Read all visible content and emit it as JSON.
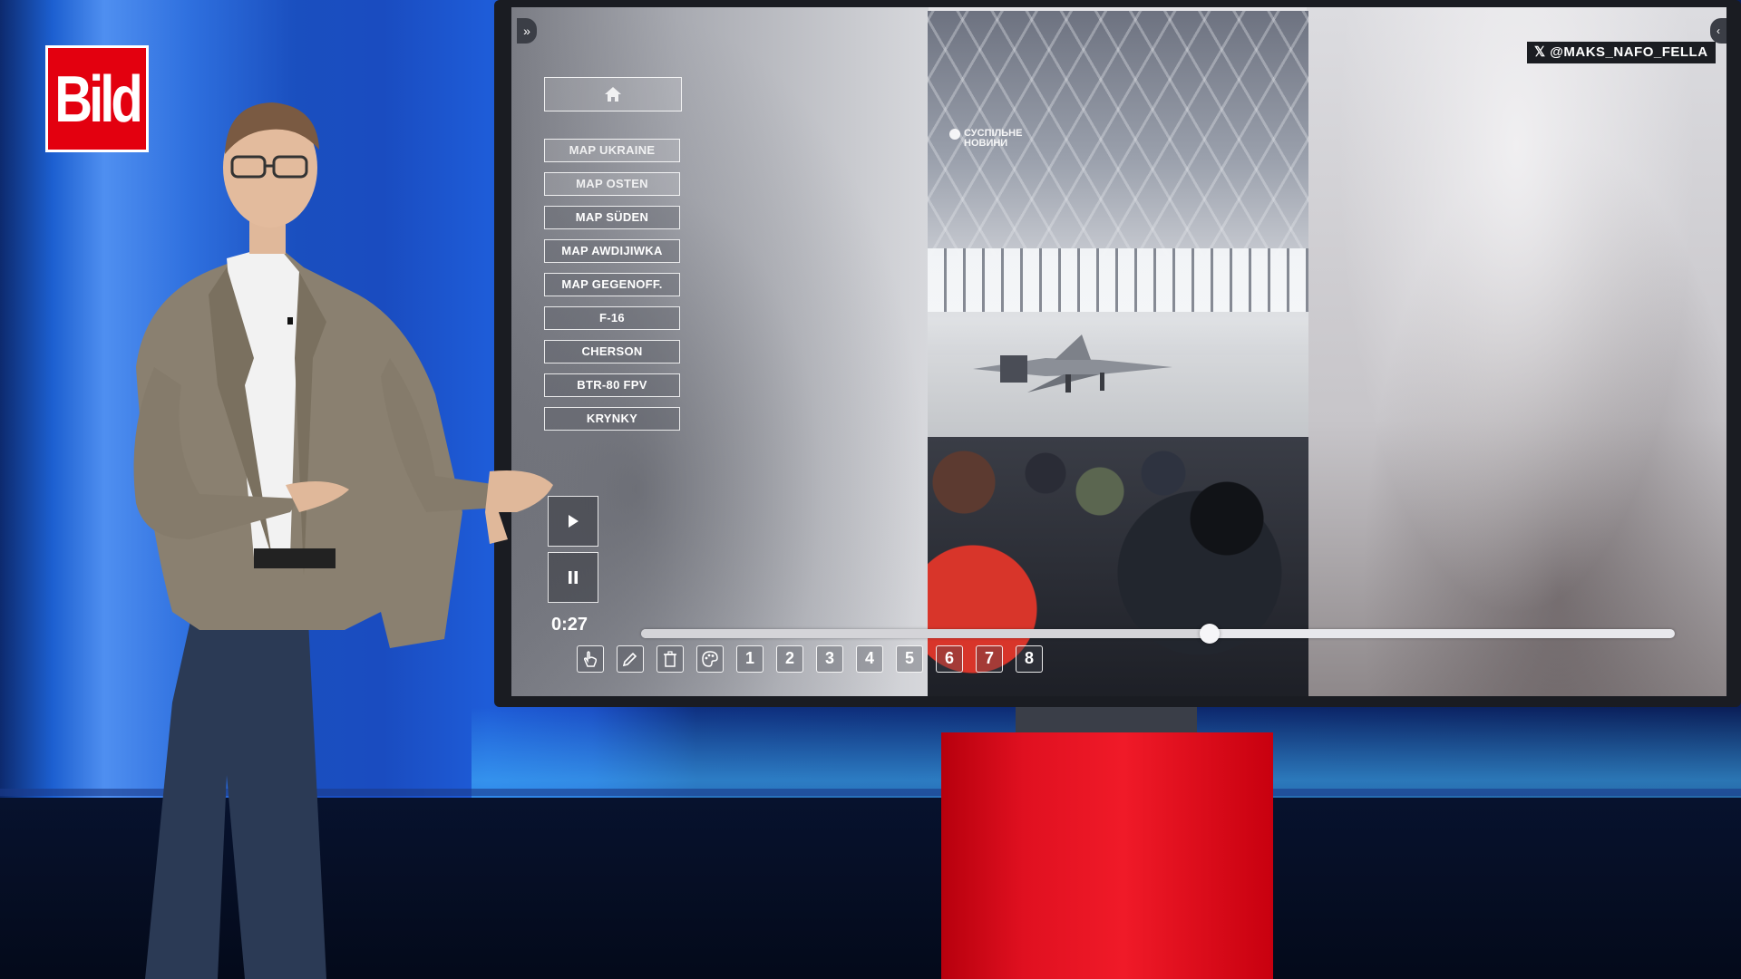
{
  "broadcast": {
    "logo_text": "Bild"
  },
  "screen": {
    "credit_text": "𝕏 @MAKS_NAFO_FELLA",
    "expand_glyph": "»",
    "video_watermark_line1": "СУСПІЛЬНЕ",
    "video_watermark_line2": "НОВИНИ",
    "menu": {
      "home_icon": "home-icon",
      "items": [
        {
          "label": "MAP UKRAINE"
        },
        {
          "label": "MAP OSTEN"
        },
        {
          "label": "MAP SÜDEN"
        },
        {
          "label": "MAP AWDIJIWKA"
        },
        {
          "label": "MAP GEGENOFF."
        },
        {
          "label": "F-16"
        },
        {
          "label": "CHERSON"
        },
        {
          "label": "BTR-80 FPV"
        },
        {
          "label": "KRYNKY"
        }
      ]
    },
    "player": {
      "time": "0:27",
      "progress_fraction": 0.55
    },
    "toolbar": {
      "tools": [
        {
          "icon": "touch-hand-icon"
        },
        {
          "icon": "pencil-icon"
        },
        {
          "icon": "trash-icon"
        },
        {
          "icon": "palette-icon"
        }
      ],
      "pages": [
        "1",
        "2",
        "3",
        "4",
        "5",
        "6",
        "7",
        "8"
      ]
    }
  },
  "colors": {
    "bild_red": "#e3000f",
    "studio_blue": "#1a4fbf",
    "pedestal_red": "#e01020"
  }
}
